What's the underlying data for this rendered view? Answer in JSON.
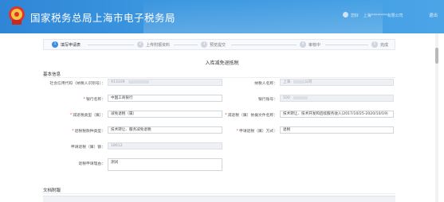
{
  "header": {
    "site_title": "国家税务总局上海市电子税务局",
    "greeting": "您好",
    "company": "上海********有限公司",
    "logout": "退出"
  },
  "steps": [
    {
      "num": "1",
      "label": "填写申请表"
    },
    {
      "num": "2",
      "label": "上传附报资料"
    },
    {
      "num": "3",
      "label": "预览提交"
    },
    {
      "num": "4",
      "label": "审核中"
    },
    {
      "num": "5",
      "label": "完成"
    }
  ],
  "form": {
    "title": "入库减免退抵税",
    "section_basic": "基本信息",
    "section_attach": "文档附報",
    "taxpayer_id_label": "社会信用代码（纳税人识别号）：",
    "taxpayer_id_value": "913109",
    "taxpayer_name_label": "纳税人名称：",
    "taxpayer_name_value": "上海",
    "taxpayer_name_suffix": "公司",
    "bank_label": "银行名称：",
    "bank_value": "中国工商银行",
    "account_label": "银行账号：",
    "account_value": "100",
    "reduction_type_label": "减退税类型（属）：",
    "reduction_type_value": "减免退税（属）",
    "doc_label": "减退税（属）依据文件名称：",
    "doc_value": "技术转让、技术开发和后续服务收入(2017/10/25-2020/10/19)",
    "refund_type_label": "退税税款种类型：",
    "refund_type_value": "技术转让、服务减免退税",
    "refund_method_label": "申请退税（属）方式：",
    "refund_method_value": "退税",
    "amount_label": "申请退税（属）额：",
    "amount_value": "18612",
    "reason_label": "退税申请理由：",
    "reason_value": "测试"
  }
}
